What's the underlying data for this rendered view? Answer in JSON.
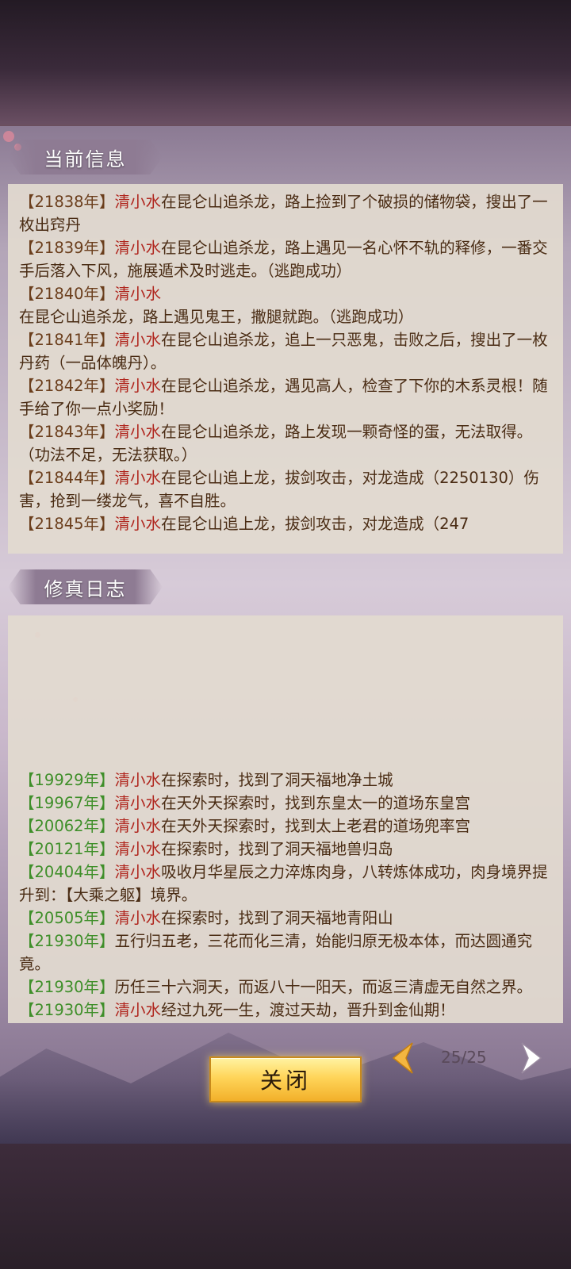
{
  "header_current": "当前信息",
  "header_log": "修真日志",
  "current_info": [
    {
      "year": "【21838年】",
      "name": "清小水",
      "text": "在昆仑山追杀龙，路上捡到了个破损的储物袋，搜出了一枚出窍丹"
    },
    {
      "year": "【21839年】",
      "name": "清小水",
      "text": "在昆仑山追杀龙，路上遇见一名心怀不轨的释修，一番交手后落入下风，施展遁术及时逃走。（逃跑成功）"
    },
    {
      "year": "【21840年】",
      "name": "清小水",
      "text": "在昆仑山追杀龙，路上遇见鬼王，撒腿就跑。（逃跑成功）"
    },
    {
      "year": "【21841年】",
      "name": "清小水",
      "text": "在昆仑山追杀龙，追上一只恶鬼，击败之后，搜出了一枚丹药（一品体魄丹）。"
    },
    {
      "year": "【21842年】",
      "name": "清小水",
      "text": "在昆仑山追杀龙，遇见高人，检查了下你的木系灵根！随手给了你一点小奖励！"
    },
    {
      "year": "【21843年】",
      "name": "清小水",
      "text": "在昆仑山追杀龙，路上发现一颗奇怪的蛋，无法取得。（功法不足，无法获取。）"
    },
    {
      "year": "【21844年】",
      "name": "清小水",
      "text": "在昆仑山追上龙，拔剑攻击，对龙造成（2250130）伤害，抢到一缕龙气，喜不自胜。"
    },
    {
      "year": "【21845年】",
      "name": "清小水",
      "text": "在昆仑山追上龙，拔剑攻击，对龙造成（247"
    }
  ],
  "cultivation_log": [
    {
      "year": "【19929年】",
      "name": "清小水",
      "text": "在探索时，找到了洞天福地净土城"
    },
    {
      "year": "【19967年】",
      "name": "清小水",
      "text": "在天外天探索时，找到东皇太一的道场东皇宫"
    },
    {
      "year": "【20062年】",
      "name": "清小水",
      "text": "在天外天探索时，找到太上老君的道场兜率宫"
    },
    {
      "year": "【20121年】",
      "name": "清小水",
      "text": "在探索时，找到了洞天福地兽归岛"
    },
    {
      "year": "【20404年】",
      "name": "清小水",
      "text": "吸收月华星辰之力淬炼肉身，八转炼体成功，肉身境界提升到：【大乘之躯】境界。"
    },
    {
      "year": "【20505年】",
      "name": "清小水",
      "text": "在探索时，找到了洞天福地青阳山"
    },
    {
      "year": "【21930年】",
      "name": "",
      "text": "五行归五老，三花而化三清，始能归原无极本体，而达圆通究竟。"
    },
    {
      "year": "【21930年】",
      "name": "",
      "text": "历任三十六洞天，而返八十一阳天，而返三清虚无自然之界。"
    },
    {
      "year": "【21930年】",
      "name": "清小水",
      "text": "经过九死一生，渡过天劫，晋升到金仙期！"
    }
  ],
  "close_label": "关闭",
  "page_indicator": "25/25",
  "colors": {
    "year_current": "#6b3e1c",
    "year_log": "#3f8f2a",
    "name": "#b0261e",
    "button": "#ffd55a"
  }
}
